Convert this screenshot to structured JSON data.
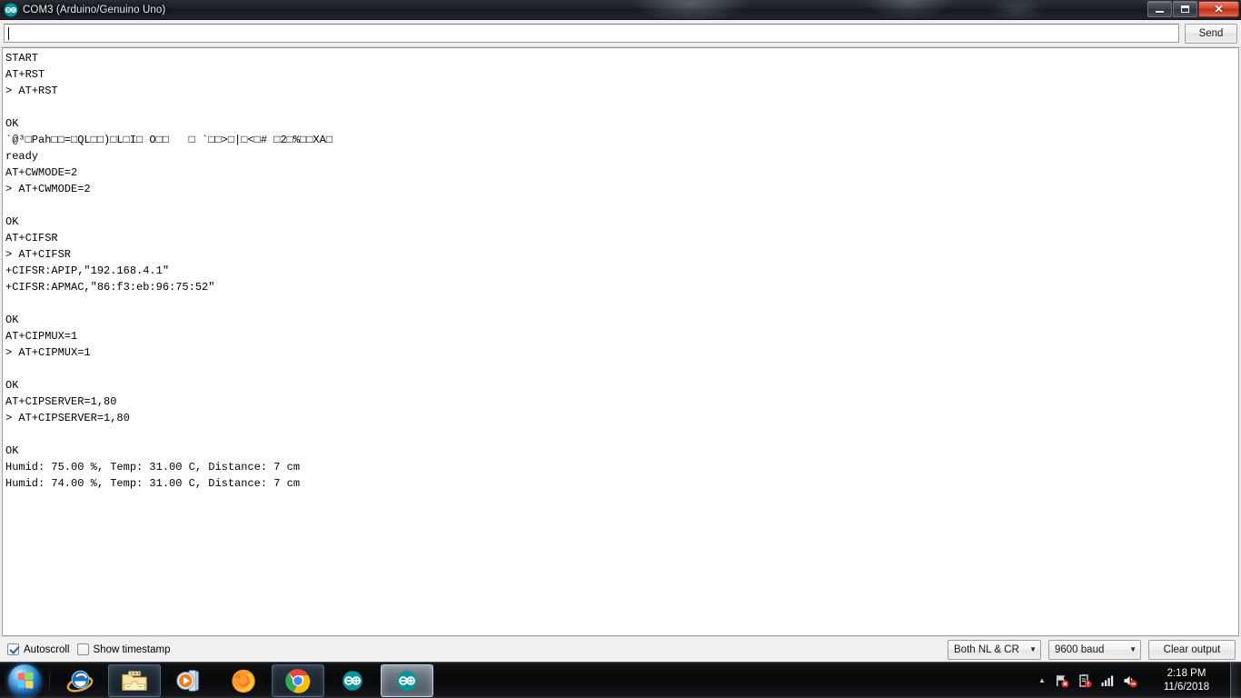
{
  "window": {
    "title": "COM3 (Arduino/Genuino Uno)",
    "icon": "arduino-infinity-icon",
    "caption": {
      "minimize_label": "Minimize",
      "restore_label": "Restore",
      "close_label": "Close"
    }
  },
  "send_row": {
    "input_value": "",
    "input_placeholder": "",
    "send_label": "Send"
  },
  "output": {
    "text": "START\nAT+RST\n> AT+RST\n\nOK\n`@³□Pah□□=□QL□□)□L□I□ O□□   □ `□□>□|□<□# □2□%□□XA□\nready\nAT+CWMODE=2\n> AT+CWMODE=2\n\nOK\nAT+CIFSR\n> AT+CIFSR\n+CIFSR:APIP,\"192.168.4.1\"\n+CIFSR:APMAC,\"86:f3:eb:96:75:52\"\n\nOK\nAT+CIPMUX=1\n> AT+CIPMUX=1\n\nOK\nAT+CIPSERVER=1,80\n> AT+CIPSERVER=1,80\n\nOK\nHumid: 75.00 %, Temp: 31.00 C, Distance: 7 cm\nHumid: 74.00 %, Temp: 31.00 C, Distance: 7 cm",
    "lines": [
      "START",
      "AT+RST",
      "> AT+RST",
      "",
      "OK",
      "`@³□Pah□□=□QL□□)□L□I□ O□□   □ `□□>□|□<□# □2□%□□XA□",
      "ready",
      "AT+CWMODE=2",
      "> AT+CWMODE=2",
      "",
      "OK",
      "AT+CIFSR",
      "> AT+CIFSR",
      "+CIFSR:APIP,\"192.168.4.1\"",
      "+CIFSR:APMAC,\"86:f3:eb:96:75:52\"",
      "",
      "OK",
      "AT+CIPMUX=1",
      "> AT+CIPMUX=1",
      "",
      "OK",
      "AT+CIPSERVER=1,80",
      "> AT+CIPSERVER=1,80",
      "",
      "OK",
      "Humid: 75.00 %, Temp: 31.00 C, Distance: 7 cm",
      "Humid: 74.00 %, Temp: 31.00 C, Distance: 7 cm"
    ]
  },
  "controls": {
    "autoscroll_label": "Autoscroll",
    "autoscroll_checked": true,
    "timestamp_label": "Show timestamp",
    "timestamp_checked": false,
    "line_ending_value": "Both NL & CR",
    "baud_value": "9600 baud",
    "clear_output_label": "Clear output"
  },
  "taskbar": {
    "start_label": "Start",
    "items": [
      {
        "name": "internet-explorer",
        "label": "Internet Explorer",
        "state": "pinned"
      },
      {
        "name": "windows-explorer",
        "label": "Windows Explorer",
        "state": "open"
      },
      {
        "name": "windows-media-player",
        "label": "Windows Media Player",
        "state": "pinned"
      },
      {
        "name": "mozilla-firefox",
        "label": "Mozilla Firefox",
        "state": "pinned"
      },
      {
        "name": "google-chrome",
        "label": "Google Chrome",
        "state": "open"
      },
      {
        "name": "arduino-ide",
        "label": "Arduino IDE",
        "state": "pinned"
      },
      {
        "name": "arduino-serial-monitor",
        "label": "COM3 (Arduino/Genuino Uno)",
        "state": "active"
      }
    ],
    "tray": {
      "overflow_label": "Show hidden icons",
      "icons": [
        "network-error-icon",
        "action-center-icon",
        "signal-bars-icon",
        "volume-muted-icon"
      ],
      "time": "2:18 PM",
      "date": "11/6/2018"
    }
  },
  "colors": {
    "accent": "#00979c",
    "title_bar": "#1c2026",
    "window_chrome": "#f0f0f0",
    "output_bg": "#ffffff",
    "output_fg": "#000000",
    "taskbar": "#08090b"
  }
}
